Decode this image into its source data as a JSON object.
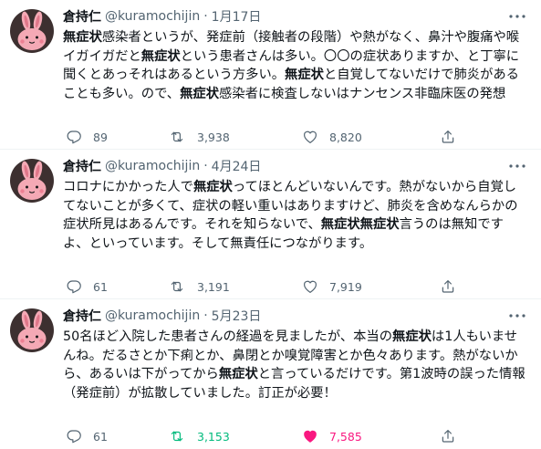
{
  "tweets": [
    {
      "display_name": "倉持仁",
      "handle": "@kuramochijin",
      "separator": "·",
      "date": "1月17日",
      "segments": [
        {
          "t": "無症状",
          "b": true
        },
        {
          "t": "感染者というが、発症前（接触者の段階）や熱がなく、鼻汁や腹痛や喉イガイガだと",
          "b": false
        },
        {
          "t": "無症状",
          "b": true
        },
        {
          "t": "という患者さんは多い。〇〇の症状ありますか、と丁寧に聞くとあっそれはあるという方多い。",
          "b": false
        },
        {
          "t": "無症状",
          "b": true
        },
        {
          "t": "と自覚してないだけで肺炎があることも多い。ので、",
          "b": false
        },
        {
          "t": "無症状",
          "b": true
        },
        {
          "t": "感染者に検査しないはナンセンス非臨床医の発想",
          "b": false
        }
      ],
      "replies": "89",
      "retweets": "3,938",
      "likes": "8,820",
      "retweeted": false,
      "liked": false
    },
    {
      "display_name": "倉持仁",
      "handle": "@kuramochijin",
      "separator": "·",
      "date": "4月24日",
      "segments": [
        {
          "t": "コロナにかかった人で",
          "b": false
        },
        {
          "t": "無症状",
          "b": true
        },
        {
          "t": "ってほとんどいないんです。熱がないから自覚してないことが多くて、症状の軽い重いはありますけど、肺炎を含めなんらかの症状所見はあるんです。それを知らないで、",
          "b": false
        },
        {
          "t": "無症状無症状",
          "b": true
        },
        {
          "t": "言うのは無知ですよ、といっています。そして無責任につながります。",
          "b": false
        }
      ],
      "replies": "61",
      "retweets": "3,191",
      "likes": "7,919",
      "retweeted": false,
      "liked": false
    },
    {
      "display_name": "倉持仁",
      "handle": "@kuramochijin",
      "separator": "·",
      "date": "5月23日",
      "segments": [
        {
          "t": "50名ほど入院した患者さんの経過を見ましたが、本当の",
          "b": false
        },
        {
          "t": "無症状",
          "b": true
        },
        {
          "t": "は1人もいませんね。だるさとか下痢とか、鼻閉とか嗅覚障害とか色々あります。熱がないから、あるいは下がってから",
          "b": false
        },
        {
          "t": "無症状",
          "b": true
        },
        {
          "t": "と言っているだけです。第1波時の誤った情報（発症前）が拡散していました。訂正が必要！",
          "b": false
        }
      ],
      "replies": "61",
      "retweets": "3,153",
      "likes": "7,585",
      "retweeted": true,
      "liked": true
    }
  ],
  "icons": {
    "avatar": "rabbit-avatar-icon",
    "more": "more-dots-icon",
    "reply": "reply-icon",
    "retweet": "retweet-icon",
    "like": "heart-icon",
    "share": "share-icon"
  },
  "colors": {
    "text": "#0f1419",
    "muted": "#536471",
    "retweet_active": "#00ba7c",
    "like_active": "#f91880",
    "avatar_bg": "#3d3030",
    "avatar_rabbit": "#f4a9b5"
  }
}
